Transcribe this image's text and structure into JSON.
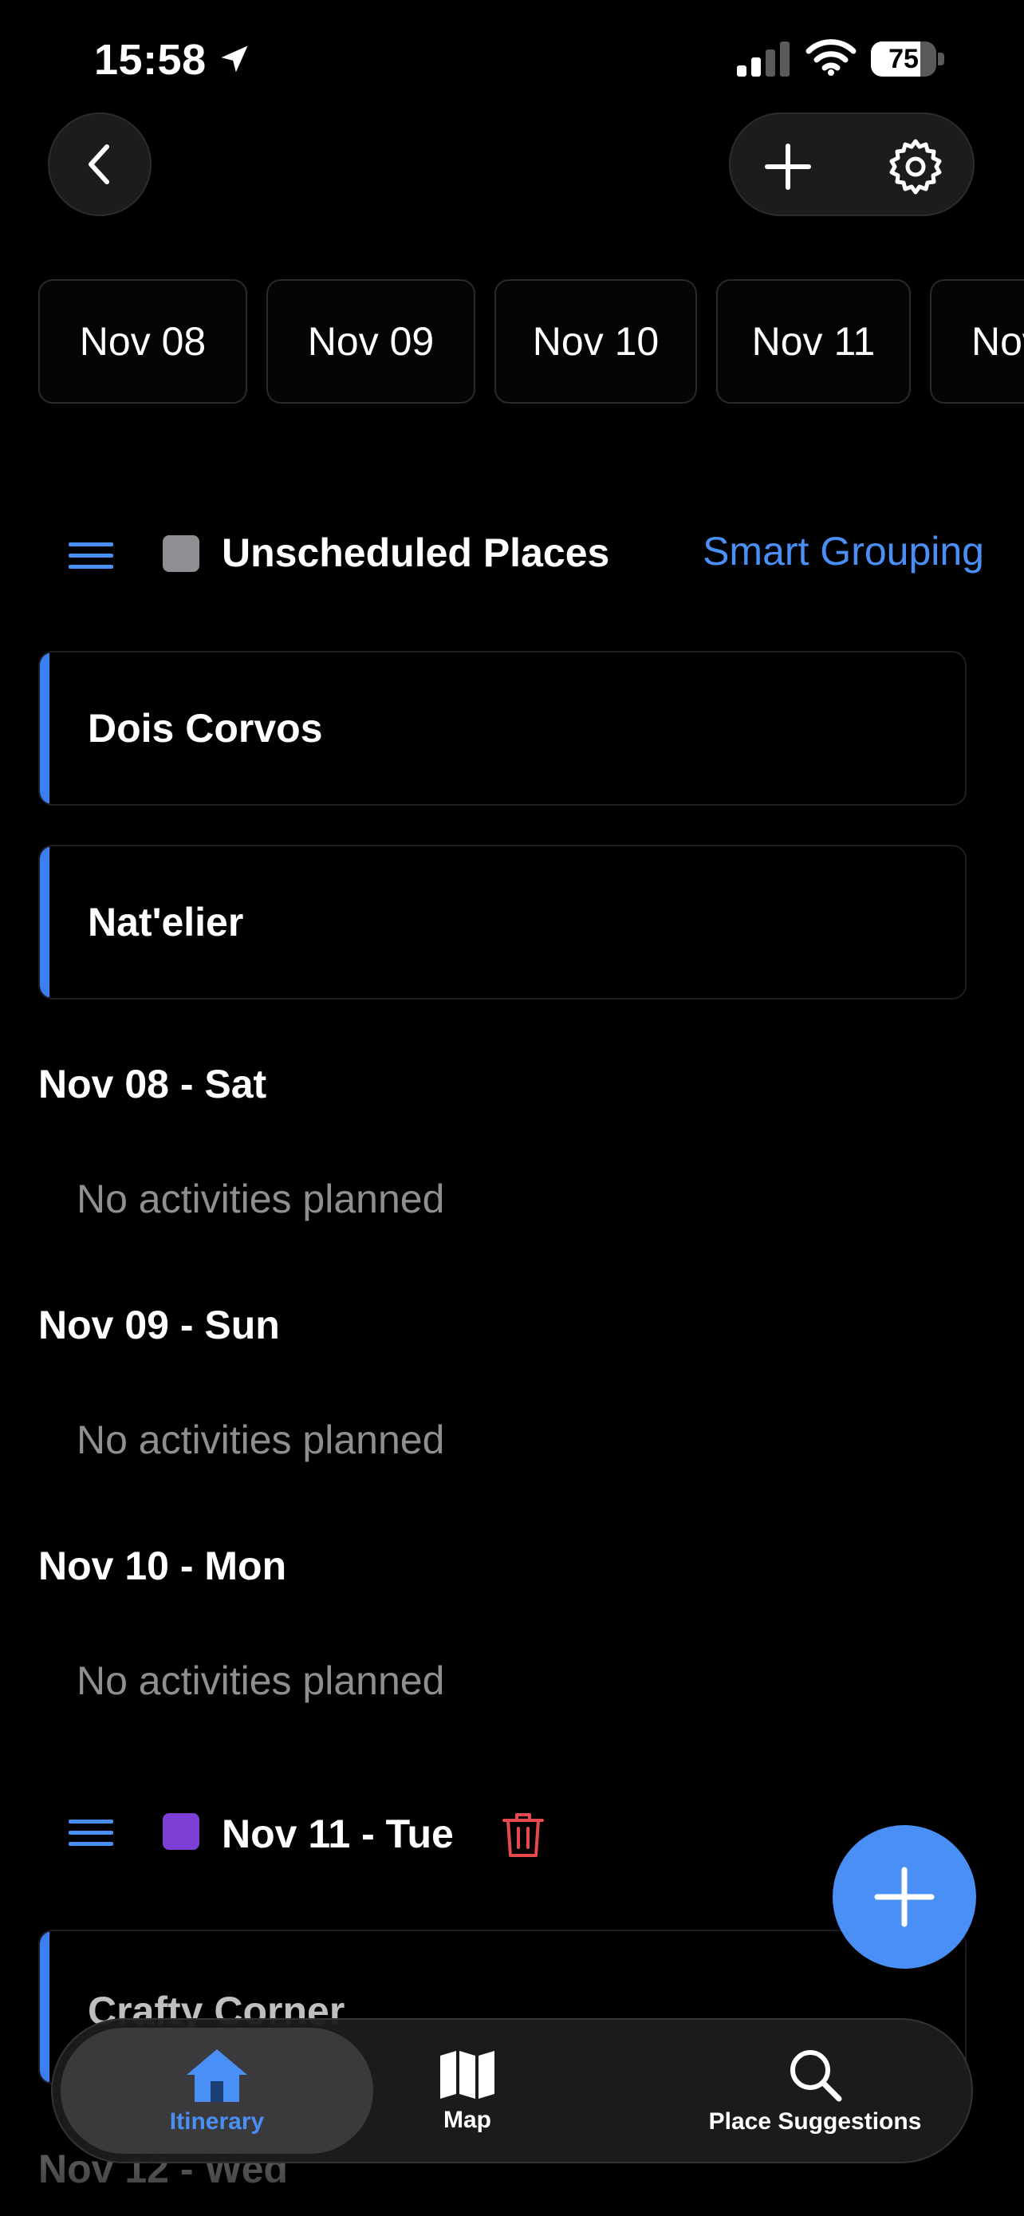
{
  "status_bar": {
    "time": "15:58",
    "battery": "75",
    "battery_fraction": 0.75
  },
  "date_tabs": [
    "Nov 08",
    "Nov 09",
    "Nov 10",
    "Nov 11",
    "Nov"
  ],
  "unscheduled": {
    "title": "Unscheduled Places",
    "action": "Smart Grouping",
    "color": "#8e8e93",
    "places": [
      "Dois Corvos",
      "Nat'elier"
    ]
  },
  "days": [
    {
      "heading": "Nov 08 - Sat",
      "empty": "No activities planned"
    },
    {
      "heading": "Nov 09 - Sun",
      "empty": "No activities planned"
    },
    {
      "heading": "Nov 10 - Mon",
      "empty": "No activities planned"
    }
  ],
  "scheduled_day": {
    "heading": "Nov 11 - Tue",
    "color": "#7b3fd6",
    "places": [
      "Crafty Corner"
    ]
  },
  "next_day_heading": "Nov 12 - Wed",
  "tab_bar": {
    "items": [
      {
        "label": "Itinerary",
        "icon": "house-icon",
        "active": true
      },
      {
        "label": "Map",
        "icon": "map-icon",
        "active": false
      },
      {
        "label": "Place Suggestions",
        "icon": "search-icon",
        "active": false
      }
    ]
  },
  "colors": {
    "accent": "#4a8ff5",
    "delete": "#e5484d"
  }
}
